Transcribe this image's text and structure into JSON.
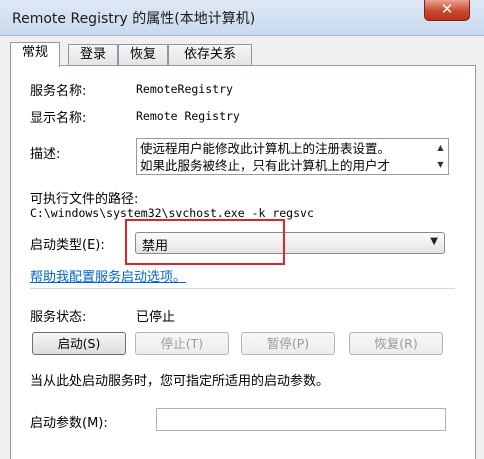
{
  "window": {
    "title": "Remote Registry 的属性(本地计算机)",
    "close_label": "✕"
  },
  "tabs": [
    {
      "label": "常规"
    },
    {
      "label": "登录"
    },
    {
      "label": "恢复"
    },
    {
      "label": "依存关系"
    }
  ],
  "general": {
    "service_name_label": "服务名称:",
    "service_name_value": "RemoteRegistry",
    "display_name_label": "显示名称:",
    "display_name_value": "Remote Registry",
    "description_label": "描述:",
    "description_line1": "使远程用户能修改此计算机上的注册表设置。",
    "description_line2": "如果此服务被终止，只有此计算机上的用户才",
    "exe_path_label": "可执行文件的路径:",
    "exe_path_value": "C:\\windows\\system32\\svchost.exe -k regsvc",
    "startup_type_label": "启动类型(E):",
    "startup_type_value": "禁用",
    "help_link": "帮助我配置服务启动选项。",
    "status_label": "服务状态:",
    "status_value": "已停止",
    "start_note": "当从此处启动服务时，您可指定所适用的启动参数。",
    "start_params_label": "启动参数(M):",
    "start_params_value": ""
  },
  "buttons": {
    "start": "启动(S)",
    "stop": "停止(T)",
    "pause": "暂停(P)",
    "resume": "恢复(R)"
  },
  "icons": {
    "scroll_up": "▲",
    "scroll_down": "▼",
    "dropdown": "▼"
  },
  "colors": {
    "highlight_border": "#e0242b",
    "link": "#0066cc"
  }
}
